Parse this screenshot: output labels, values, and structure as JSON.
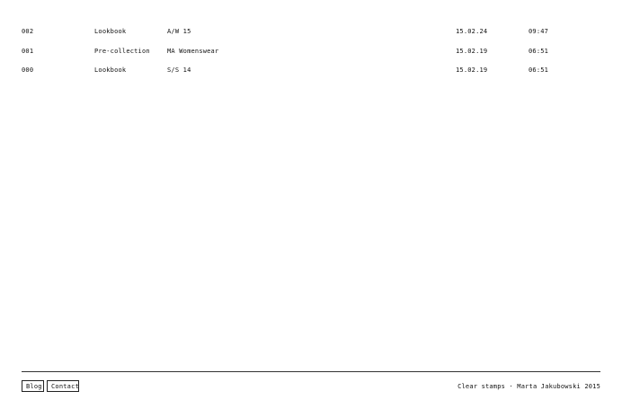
{
  "entries": [
    {
      "number": "002",
      "type": "Lookbook",
      "title": "A/W 15",
      "date": "15.02.24",
      "time": "09:47"
    },
    {
      "number": "001",
      "type": "Pre-collection",
      "title": "MA Womenswear",
      "date": "15.02.19",
      "time": "06:51"
    },
    {
      "number": "000",
      "type": "Lookbook",
      "title": "S/S 14",
      "date": "15.02.19",
      "time": "06:51"
    }
  ],
  "footer": {
    "blog_label": "Blog",
    "contact_label": "Contact",
    "credits": "Clear stamps · Marta Jakubowski 2015"
  }
}
